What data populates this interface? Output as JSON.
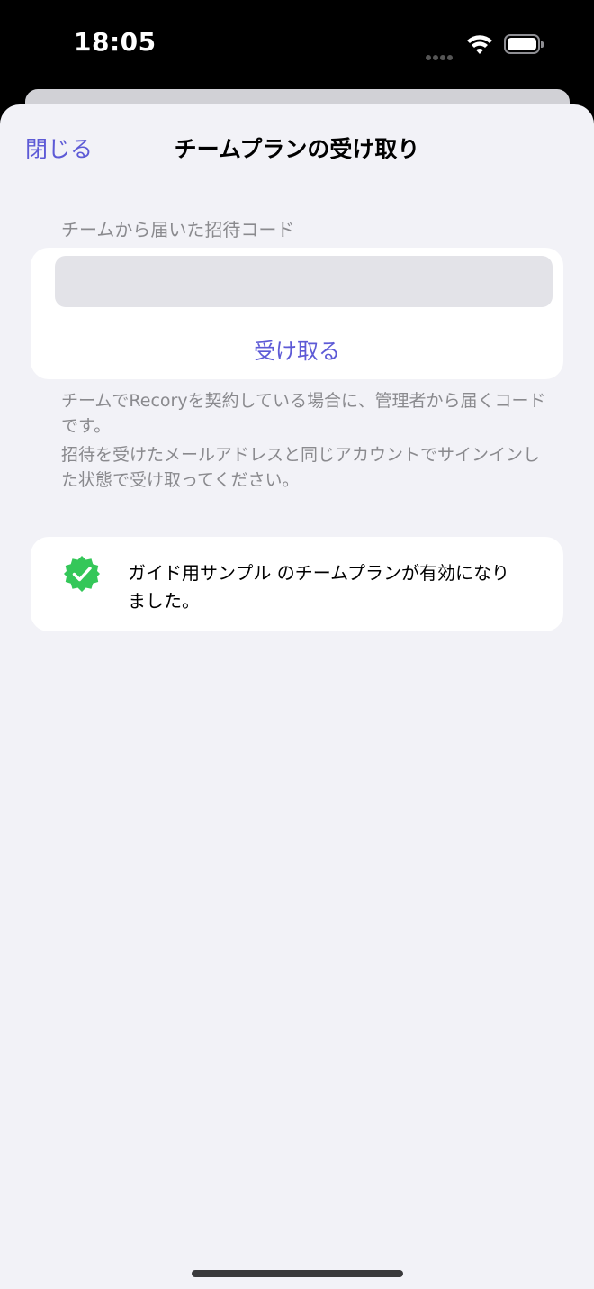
{
  "status_bar": {
    "time": "18:05"
  },
  "nav": {
    "close_label": "閉じる",
    "title": "チームプランの受け取り"
  },
  "invite": {
    "section_label": "チームから届いた招待コード",
    "code_value": "",
    "receive_label": "受け取る"
  },
  "help": {
    "paragraph1": "チームでRecoryを契約している場合に、管理者から届くコードです。",
    "paragraph2": "招待を受けたメールアドレスと同じアカウントでサインインした状態で受け取ってください。"
  },
  "success": {
    "message": "ガイド用サンプル のチームプランが有効になりました。",
    "icon": "checkmark-seal-icon"
  },
  "colors": {
    "accent": "#5d5ad6",
    "success": "#34c759",
    "background": "#f2f2f7"
  }
}
